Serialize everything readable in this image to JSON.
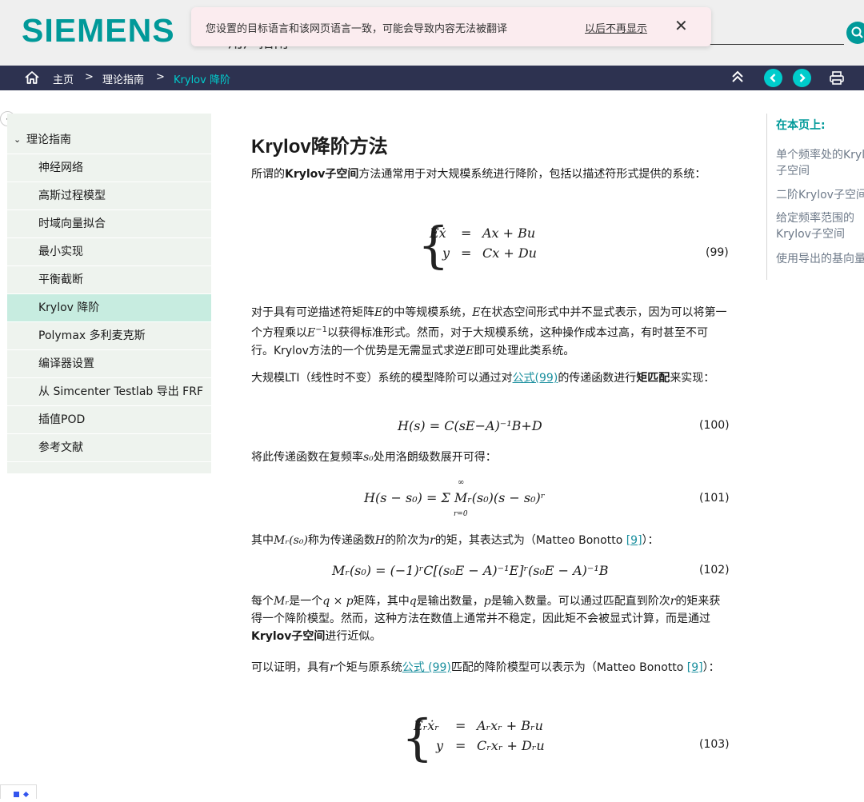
{
  "header": {
    "logo": "SIEMENS",
    "subtitle": "用户指南",
    "colors": {
      "brand": "#009999",
      "navbar": "#2d3250",
      "accent": "#00cccc"
    }
  },
  "translate_popup": {
    "message": "您设置的目标语言和该网页语言一致，可能会导致内容无法被翻译",
    "dismiss_link": "以后不再显示",
    "close_icon": "close-icon"
  },
  "breadcrumb": {
    "home": "主页",
    "separator": ">",
    "level1": "理论指南",
    "current": "Krylov 降阶"
  },
  "sidebar": {
    "collapse_icon": "chevron-left-icon",
    "header": "理论指南",
    "items": [
      {
        "label": "神经网络"
      },
      {
        "label": "高斯过程模型"
      },
      {
        "label": "时域向量拟合"
      },
      {
        "label": "最小实现"
      },
      {
        "label": "平衡截断"
      },
      {
        "label": "Krylov 降阶",
        "active": true
      },
      {
        "label": "Polymax  多利麦克斯"
      },
      {
        "label": "编译器设置"
      },
      {
        "label": "从 Simcenter Testlab 导出 FRF"
      },
      {
        "label": "插值POD"
      },
      {
        "label": "参考文献"
      }
    ]
  },
  "article": {
    "title": "Krylov降阶方法",
    "p1": {
      "a": "所谓的",
      "b": "Krylov子空间",
      "c": "方法通常用于对大规模系统进行降阶，包括以描述符形式提供的系统："
    },
    "eq99": {
      "line1_lhs": "Eẋ",
      "line1_eq": "=",
      "line1_rhs": "Ax + Bu",
      "line2_lhs": "y",
      "line2_eq": "=",
      "line2_rhs": "Cx + Du",
      "number": "(99)"
    },
    "p2": {
      "a": "对于具有可逆描述符矩阵",
      "E1": "E",
      "b": "的中等规模系统，",
      "E2": "E",
      "c": "在状态空间形式中并不显式表示，因为可以将第一个方程乘以",
      "E3": "E",
      "sup": "−1",
      "d": "以获得标准形式。然而，对于大规模系统，这种操作成本过高，有时甚至不可行。Krylov方法的一个优势是无需显式求逆",
      "E4": "E",
      "e": "即可处理此类系统。"
    },
    "p3": {
      "a": "大规模LTI（线性时不变）系统的模型降阶可以通过对",
      "link": "公式(99)",
      "b": "的传递函数进行",
      "bold": "矩匹配",
      "c": "来实现："
    },
    "eq100": {
      "text": "H(s) = C(sE−A)⁻¹B+D",
      "number": "(100)"
    },
    "p4": {
      "a": "将此传递函数在复频率",
      "s0": "s₀",
      "b": "处用洛朗级数展开可得："
    },
    "eq101": {
      "text": "H(s − s₀) = Σ Mᵣ(s₀)(s − s₀)ʳ",
      "sum_top": "∞",
      "sum_bottom": "r=0",
      "number": "(101)"
    },
    "p5": {
      "a": "其中",
      "m": "Mᵣ(s₀)",
      "b": "称为传递函数",
      "h": "H",
      "c": "的阶次为",
      "r": "r",
      "d": "的矩，其表达式为（Matteo Bonotto ",
      "ref": "[9]",
      "e": "）："
    },
    "eq102": {
      "text": "Mᵣ(s₀) = (−1)ʳC[(s₀E − A)⁻¹E]ʳ(s₀E − A)⁻¹B",
      "number": "(102)"
    },
    "p6": {
      "a": "每个",
      "m": "Mᵣ",
      "b": "是一个",
      "qp": "q × p",
      "c": "矩阵，其中",
      "q": "q",
      "d": "是输出数量，",
      "p": "p",
      "e": "是输入数量。可以通过匹配直到阶次",
      "r": "r",
      "f": "的矩来获得一个降阶模型。然而，这种方法在数值上通常并不稳定，因此矩不会被显式计算，而是通过",
      "bold": "Krylov子空间",
      "g": "进行近似。"
    },
    "p7": {
      "a": "可以证明，具有",
      "r": "r",
      "b": "个矩与原系统",
      "link": "公式 (99)",
      "c": "匹配的降阶模型可以表示为（Matteo Bonotto ",
      "ref": "[9]",
      "d": "）："
    },
    "eq103": {
      "line1_lhs": "Eᵣẋᵣ",
      "line1_eq": "=",
      "line1_rhs": "Aᵣxᵣ + Bᵣu",
      "line2_lhs": "y",
      "line2_eq": "=",
      "line2_rhs": "Cᵣxᵣ + Dᵣu",
      "number": "(103)"
    }
  },
  "toc": {
    "title": "在本页上:",
    "items": [
      "单个频率处的Krylov子空间",
      "二阶Krylov子空间",
      "给定频率范围的Krylov子空间",
      "使用导出的基向量"
    ]
  }
}
